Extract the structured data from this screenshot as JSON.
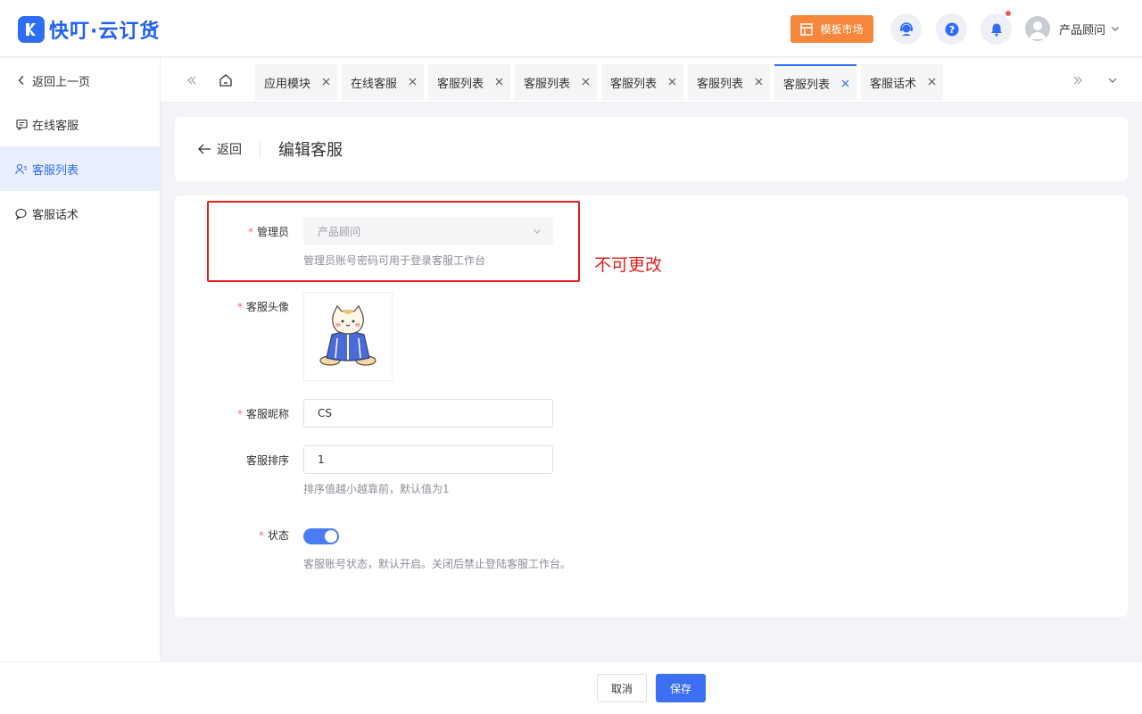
{
  "brand": {
    "name": "快叮·云订货",
    "color": "#2f6df6"
  },
  "header": {
    "market_label": "模板市场",
    "user_name": "产品顾问",
    "icons": [
      "service-icon",
      "help-icon",
      "bell-icon"
    ]
  },
  "sidebar": {
    "items": [
      {
        "label": "返回上一页",
        "icon": "chevron-left-icon"
      },
      {
        "label": "在线客服",
        "icon": "message-icon"
      },
      {
        "label": "客服列表",
        "icon": "users-icon",
        "active": true
      },
      {
        "label": "客服话术",
        "icon": "chat-icon"
      }
    ]
  },
  "tabs": [
    {
      "label": "应用模块"
    },
    {
      "label": "在线客服"
    },
    {
      "label": "客服列表"
    },
    {
      "label": "客服列表"
    },
    {
      "label": "客服列表"
    },
    {
      "label": "客服列表"
    },
    {
      "label": "客服列表",
      "active": true
    },
    {
      "label": "客服话术"
    }
  ],
  "page": {
    "back_label": "返回",
    "title": "编辑客服"
  },
  "form": {
    "admin": {
      "label": "管理员",
      "value": "产品顾问",
      "hint": "管理员账号密码可用于登录客服工作台"
    },
    "annotation": "不可更改",
    "avatar": {
      "label": "客服头像"
    },
    "nickname": {
      "label": "客服昵称",
      "value": "CS"
    },
    "sort": {
      "label": "客服排序",
      "value": "1",
      "hint": "排序值越小越靠前，默认值为1"
    },
    "status": {
      "label": "状态",
      "on": true,
      "hint": "客服账号状态，默认开启。关闭后禁止登陆客服工作台。"
    }
  },
  "footer": {
    "cancel_label": "取消",
    "save_label": "保存"
  },
  "colors": {
    "accent": "#3c6ff1",
    "market": "#f5863a",
    "annotation": "#e02020",
    "required": "#f56c6c"
  }
}
